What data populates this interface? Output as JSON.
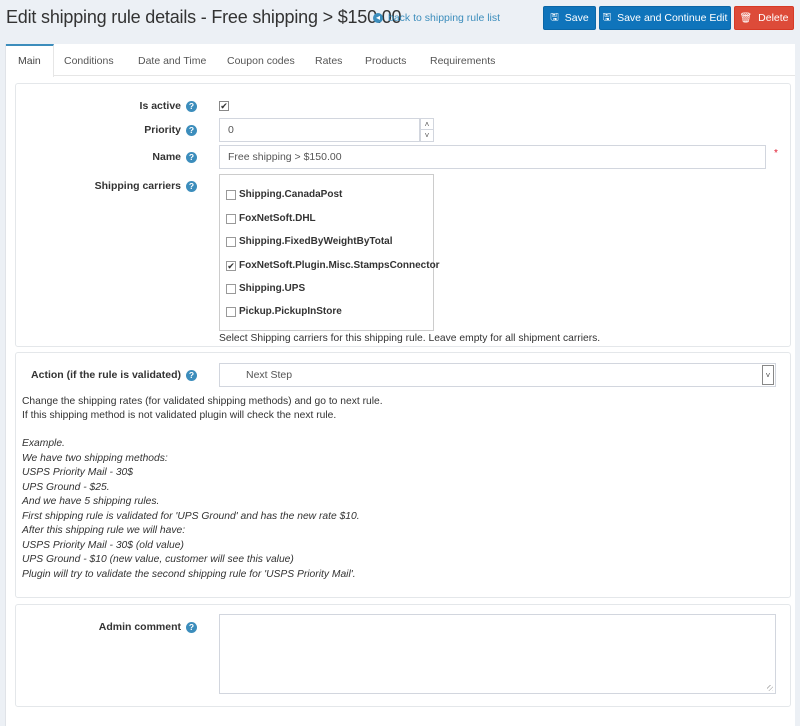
{
  "header": {
    "title": "Edit shipping rule details - Free shipping > $150.00",
    "back_link": "back to shipping rule list",
    "buttons": {
      "save": "Save",
      "save_continue": "Save and Continue Edit",
      "delete": "Delete"
    }
  },
  "tabs": [
    {
      "label": "Main",
      "active": true
    },
    {
      "label": "Conditions"
    },
    {
      "label": "Date and Time"
    },
    {
      "label": "Coupon codes"
    },
    {
      "label": "Rates"
    },
    {
      "label": "Products"
    },
    {
      "label": "Requirements"
    }
  ],
  "main": {
    "is_active": {
      "label": "Is active",
      "checked": true
    },
    "priority": {
      "label": "Priority",
      "value": "0"
    },
    "name": {
      "label": "Name",
      "value": "Free shipping > $150.00",
      "required_mark": "*"
    },
    "shipping_carriers": {
      "label": "Shipping carriers",
      "items": [
        {
          "label": "Shipping.CanadaPost",
          "checked": false
        },
        {
          "label": "FoxNetSoft.DHL",
          "checked": false
        },
        {
          "label": "Shipping.FixedByWeightByTotal",
          "checked": false
        },
        {
          "label": "FoxNetSoft.Plugin.Misc.StampsConnector",
          "checked": true
        },
        {
          "label": "Shipping.UPS",
          "checked": false
        },
        {
          "label": "Pickup.PickupInStore",
          "checked": false
        }
      ],
      "hint": "Select Shipping carriers for this shipping rule. Leave empty for all shipment carriers."
    }
  },
  "action": {
    "label": "Action (if the rule is validated)",
    "selected": "Next Step",
    "description": [
      "Change the shipping rates (for validated shipping methods) and go to next rule.",
      "If this shipping method is not validated plugin will check the next rule."
    ],
    "example": [
      "Example.",
      "We have two shipping methods:",
      "USPS Priority Mail - 30$",
      "UPS Ground - $25.",
      "And we have 5 shipping rules.",
      "First shipping rule is validated for 'UPS Ground' and has the new rate $10.",
      "After this shipping rule we will have:",
      "USPS Priority Mail - 30$ (old value)",
      "UPS Ground - $10 (new value, customer will see this value)",
      "Plugin will try to validate the second shipping rule for 'USPS Priority Mail'."
    ]
  },
  "admin_comment": {
    "label": "Admin comment",
    "value": ""
  },
  "icons": {
    "help": "?",
    "check": "✔",
    "back": "◂",
    "save": "🖫",
    "delete": "🗑",
    "up": "˄",
    "down": "˅",
    "select_arrow": "˅"
  }
}
